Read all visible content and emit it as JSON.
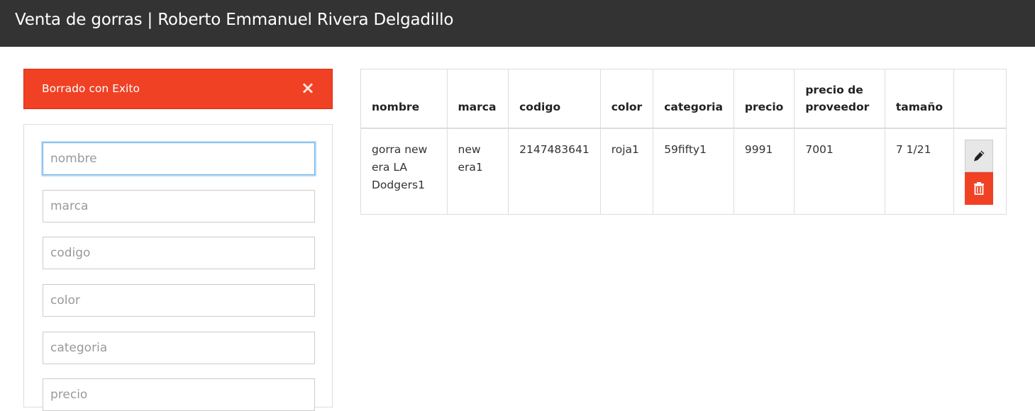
{
  "header": {
    "title": "Venta de gorras | Roberto Emmanuel Rivera Delgadillo"
  },
  "alert": {
    "message": "Borrado con Exito",
    "close_symbol": "×",
    "color": "#f04124"
  },
  "form": {
    "fields": [
      {
        "placeholder": "nombre",
        "value": ""
      },
      {
        "placeholder": "marca",
        "value": ""
      },
      {
        "placeholder": "codigo",
        "value": ""
      },
      {
        "placeholder": "color",
        "value": ""
      },
      {
        "placeholder": "categoria",
        "value": ""
      },
      {
        "placeholder": "precio",
        "value": ""
      }
    ]
  },
  "table": {
    "headers": [
      "nombre",
      "marca",
      "codigo",
      "color",
      "categoria",
      "precio",
      "precio de proveedor",
      "tamaño",
      ""
    ],
    "rows": [
      {
        "nombre": "gorra new era LA Dodgers1",
        "marca": "new era1",
        "codigo": "2147483641",
        "color": "roja1",
        "categoria": "59fifty1",
        "precio": "9991",
        "precio_proveedor": "7001",
        "tamano": "7 1/21",
        "actions": {
          "edit_icon": "pencil-icon",
          "delete_icon": "trash-icon"
        }
      }
    ]
  }
}
